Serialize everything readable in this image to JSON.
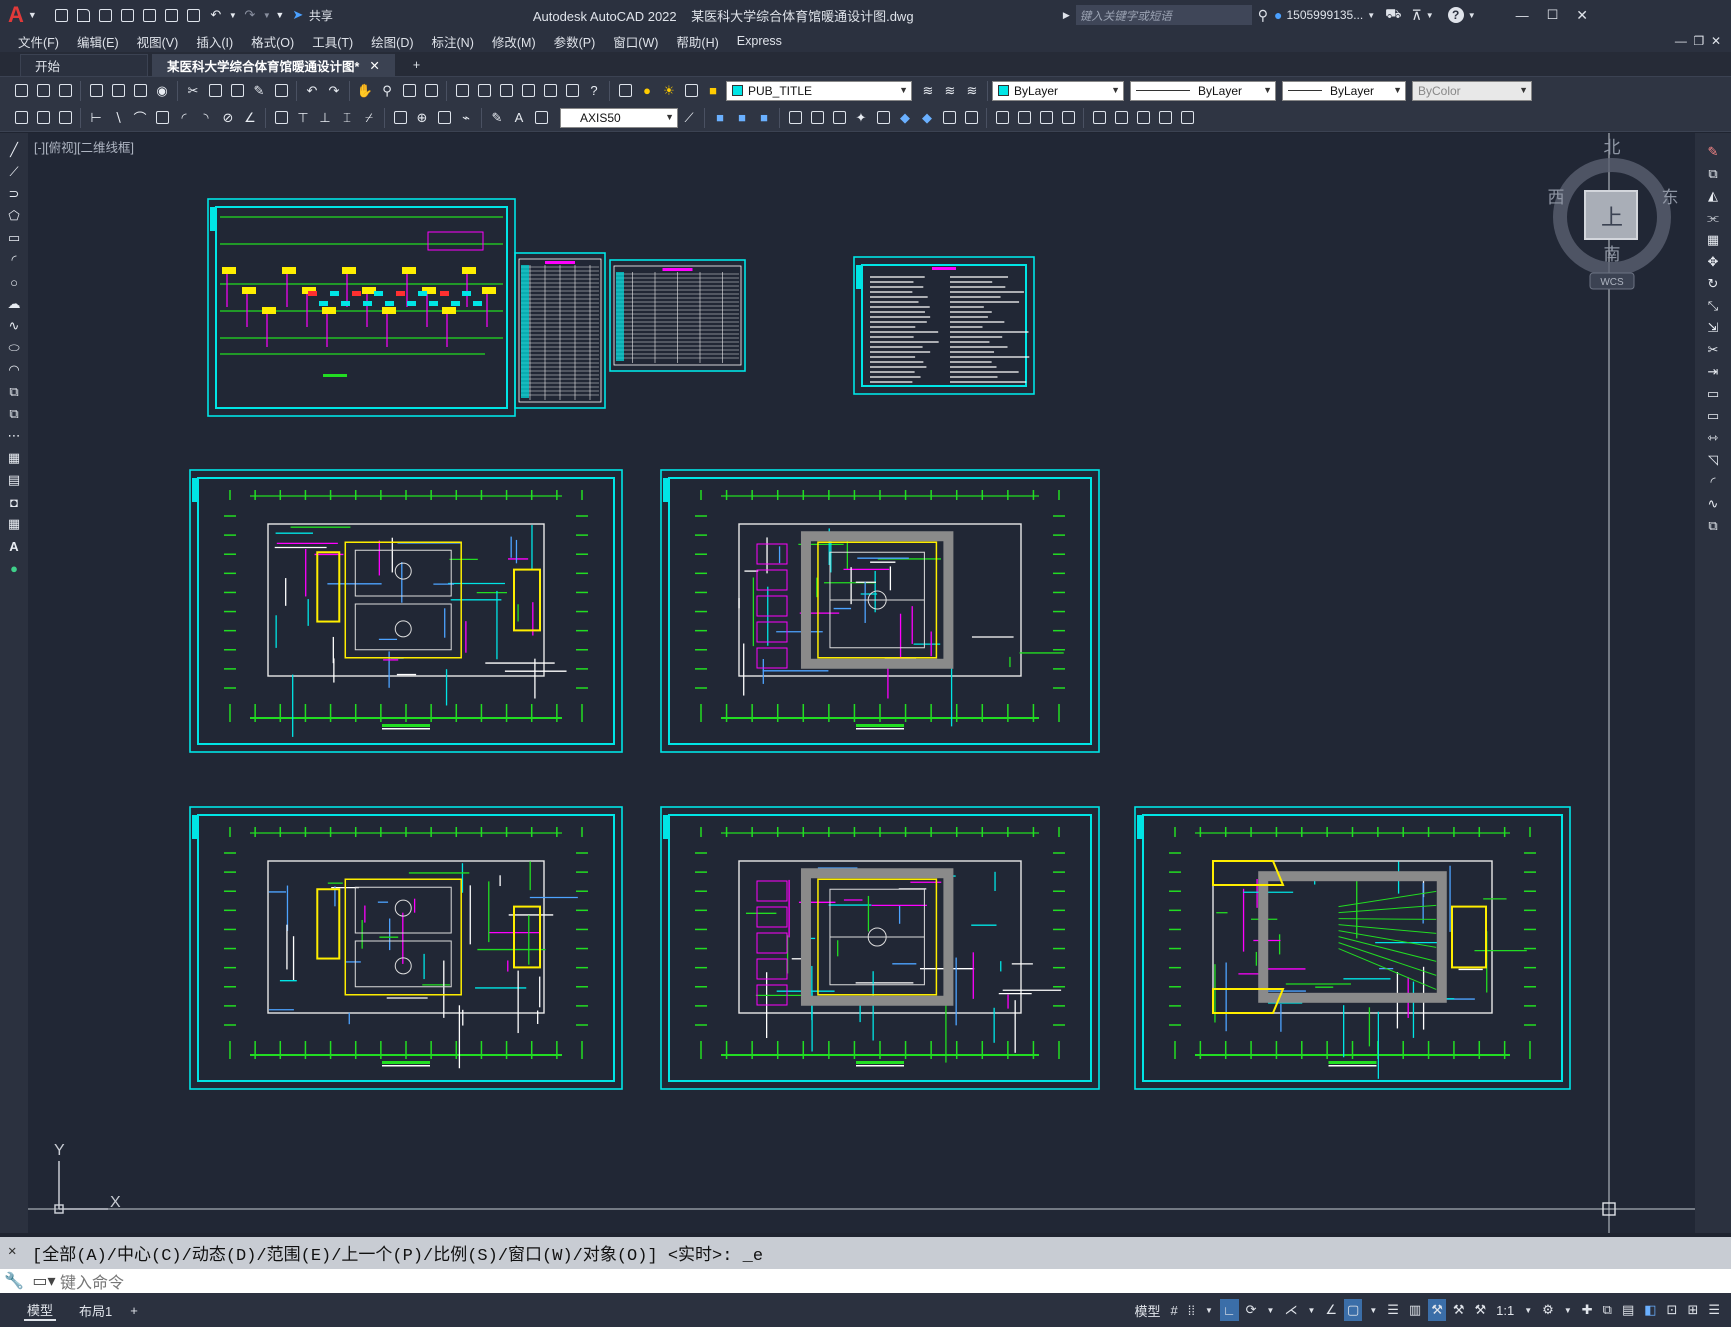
{
  "app": {
    "logo_letter": "A",
    "title": "Autodesk AutoCAD 2022    某医科大学综合体育馆暖通设计图.dwg",
    "share_label": "共享",
    "search_placeholder": "键入关键字或短语",
    "user": "1505999135...",
    "window_controls": [
      "—",
      "☐",
      "✕"
    ]
  },
  "menu": [
    "文件(F)",
    "编辑(E)",
    "视图(V)",
    "插入(I)",
    "格式(O)",
    "工具(T)",
    "绘图(D)",
    "标注(N)",
    "修改(M)",
    "参数(P)",
    "窗口(W)",
    "帮助(H)",
    "Express"
  ],
  "tabs": [
    {
      "label": "开始",
      "active": false
    },
    {
      "label": "某医科大学综合体育馆暖通设计图*",
      "active": true
    }
  ],
  "toolbar": {
    "layer_name": "PUB_TITLE",
    "color": "ByLayer",
    "linetype": "ByLayer",
    "lineweight": "ByLayer",
    "plotstyle": "ByColor",
    "dimstyle": "AXIS50"
  },
  "viewport": {
    "label": "[-][俯视][二维线框]",
    "compass": {
      "north": "北",
      "south": "南",
      "east": "东",
      "west": "西",
      "center": "上",
      "wcs": "WCS"
    },
    "ucs": {
      "x": "X",
      "y": "Y"
    }
  },
  "command": {
    "history": "[全部(A)/中心(C)/动态(D)/范围(E)/上一个(P)/比例(S)/窗口(W)/对象(O)] <实时>: _e",
    "placeholder": "键入命令"
  },
  "status": {
    "layout_tabs": [
      "模型",
      "布局1"
    ],
    "model_label": "模型",
    "scale": "1:1"
  },
  "colors": {
    "canvas": "#212735",
    "frame": "#00e5e5",
    "grid_green": "#22dd22",
    "yellow": "#ffee00",
    "magenta": "#ff00ff",
    "accent": "#3b6ea8"
  }
}
